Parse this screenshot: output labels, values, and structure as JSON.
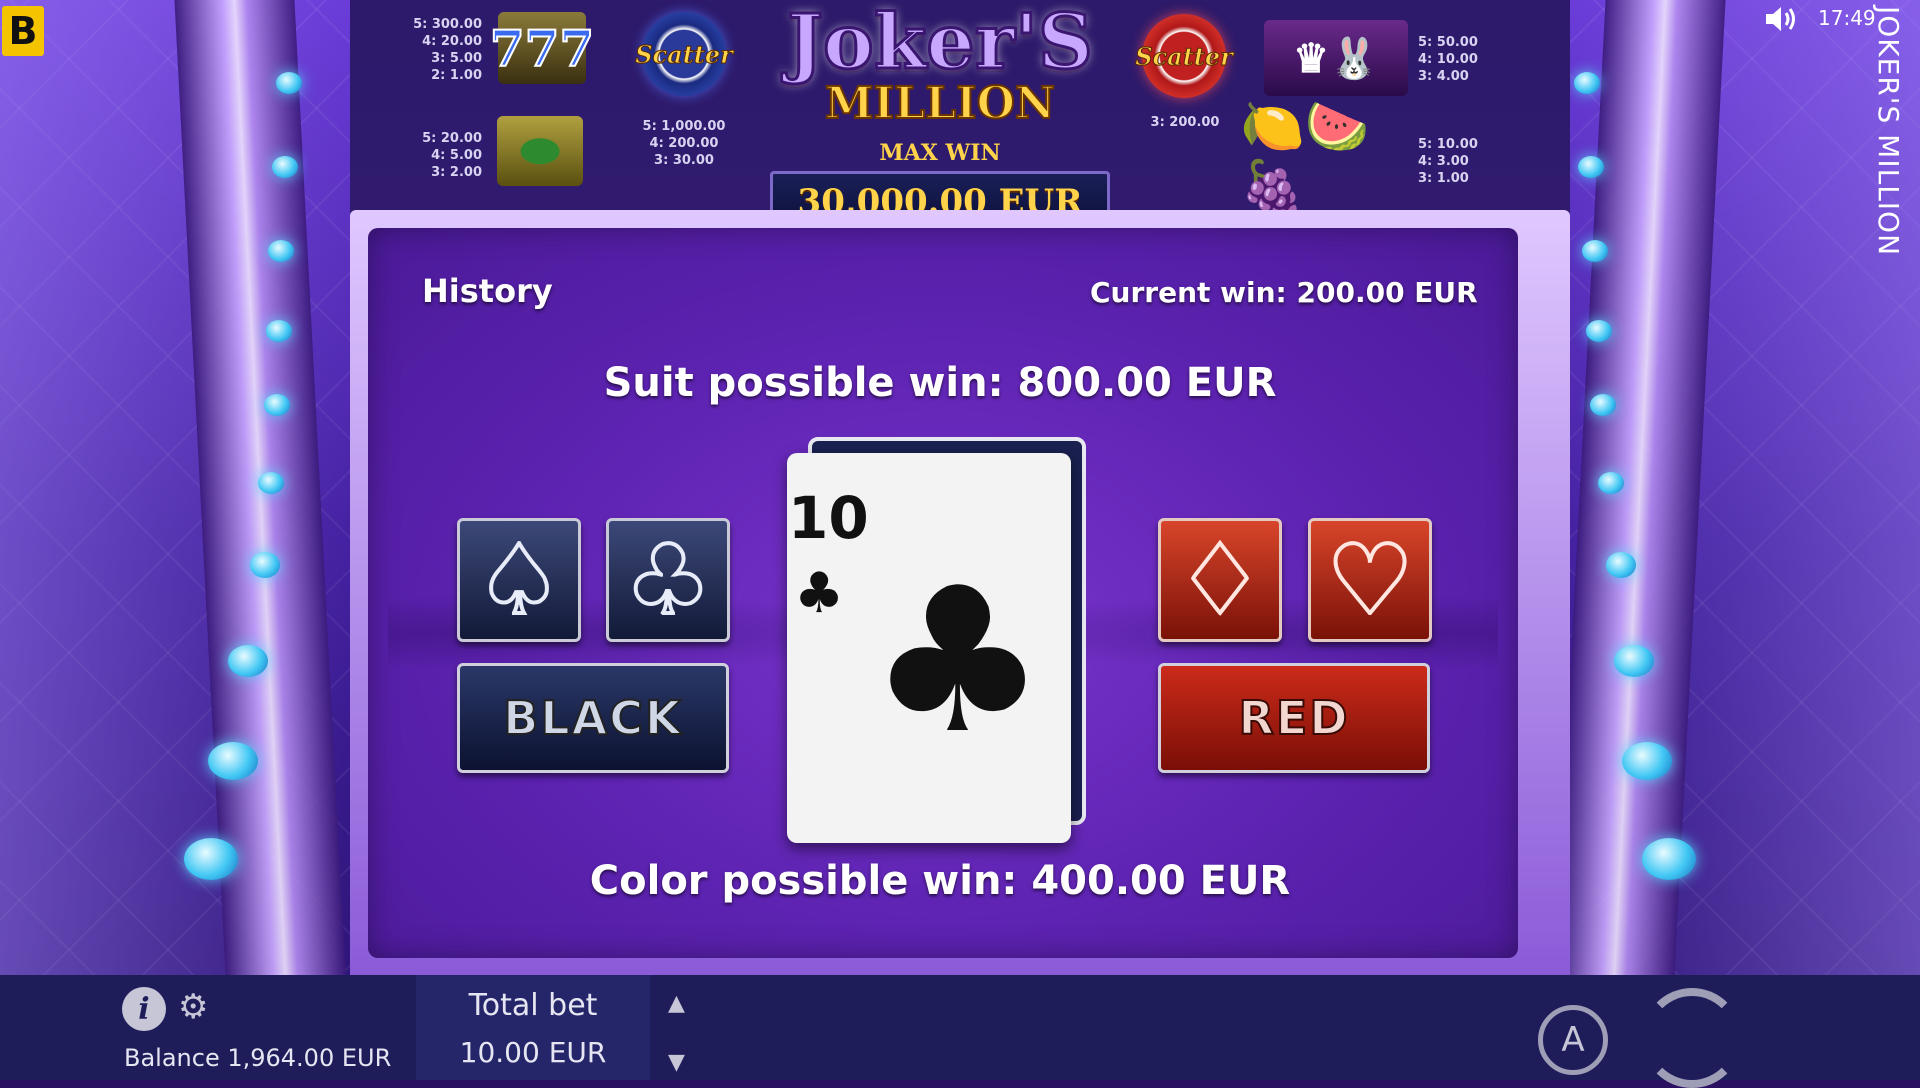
{
  "brand": {
    "logo_letter": "B"
  },
  "status_bar": {
    "time": "17:49",
    "sound_icon": "speaker-icon"
  },
  "game_title_vertical": "JOKER'S MILLION",
  "logo": {
    "title": "Joker'S",
    "subtitle": "MILLION",
    "max_win_label": "MAX WIN",
    "max_win_value": "30,000.00 EUR"
  },
  "paytable": {
    "sevens": "5: 300.00\n4: 20.00\n3: 5.00\n2: 1.00",
    "watermelon": "5: 20.00\n4: 5.00\n3: 2.00",
    "scatter_blue_label": "Scatter",
    "scatter_blue": "5: 1,000.00\n4: 200.00\n3: 30.00",
    "scatter_red_label": "Scatter",
    "scatter_red": "3: 200.00",
    "joker": "5: 50.00\n4: 10.00\n3: 4.00",
    "fruits": "5: 10.00\n4: 3.00\n3: 1.00"
  },
  "gamble": {
    "history_label": "History",
    "current_win": "Current win: 200.00 EUR",
    "suit_possible_win": "Suit possible win: 800.00 EUR",
    "color_possible_win": "Color possible win: 400.00 EUR",
    "black_label": "BLACK",
    "red_label": "RED",
    "suits": {
      "spade": "♠",
      "club": "♣",
      "diamond": "♦",
      "heart": "♥"
    },
    "card": {
      "rank": "10",
      "suit": "♣"
    }
  },
  "bottom": {
    "balance": "Balance 1,964.00 EUR",
    "total_bet_label": "Total bet",
    "total_bet_value": "10.00 EUR",
    "autoplay_label": "A"
  }
}
